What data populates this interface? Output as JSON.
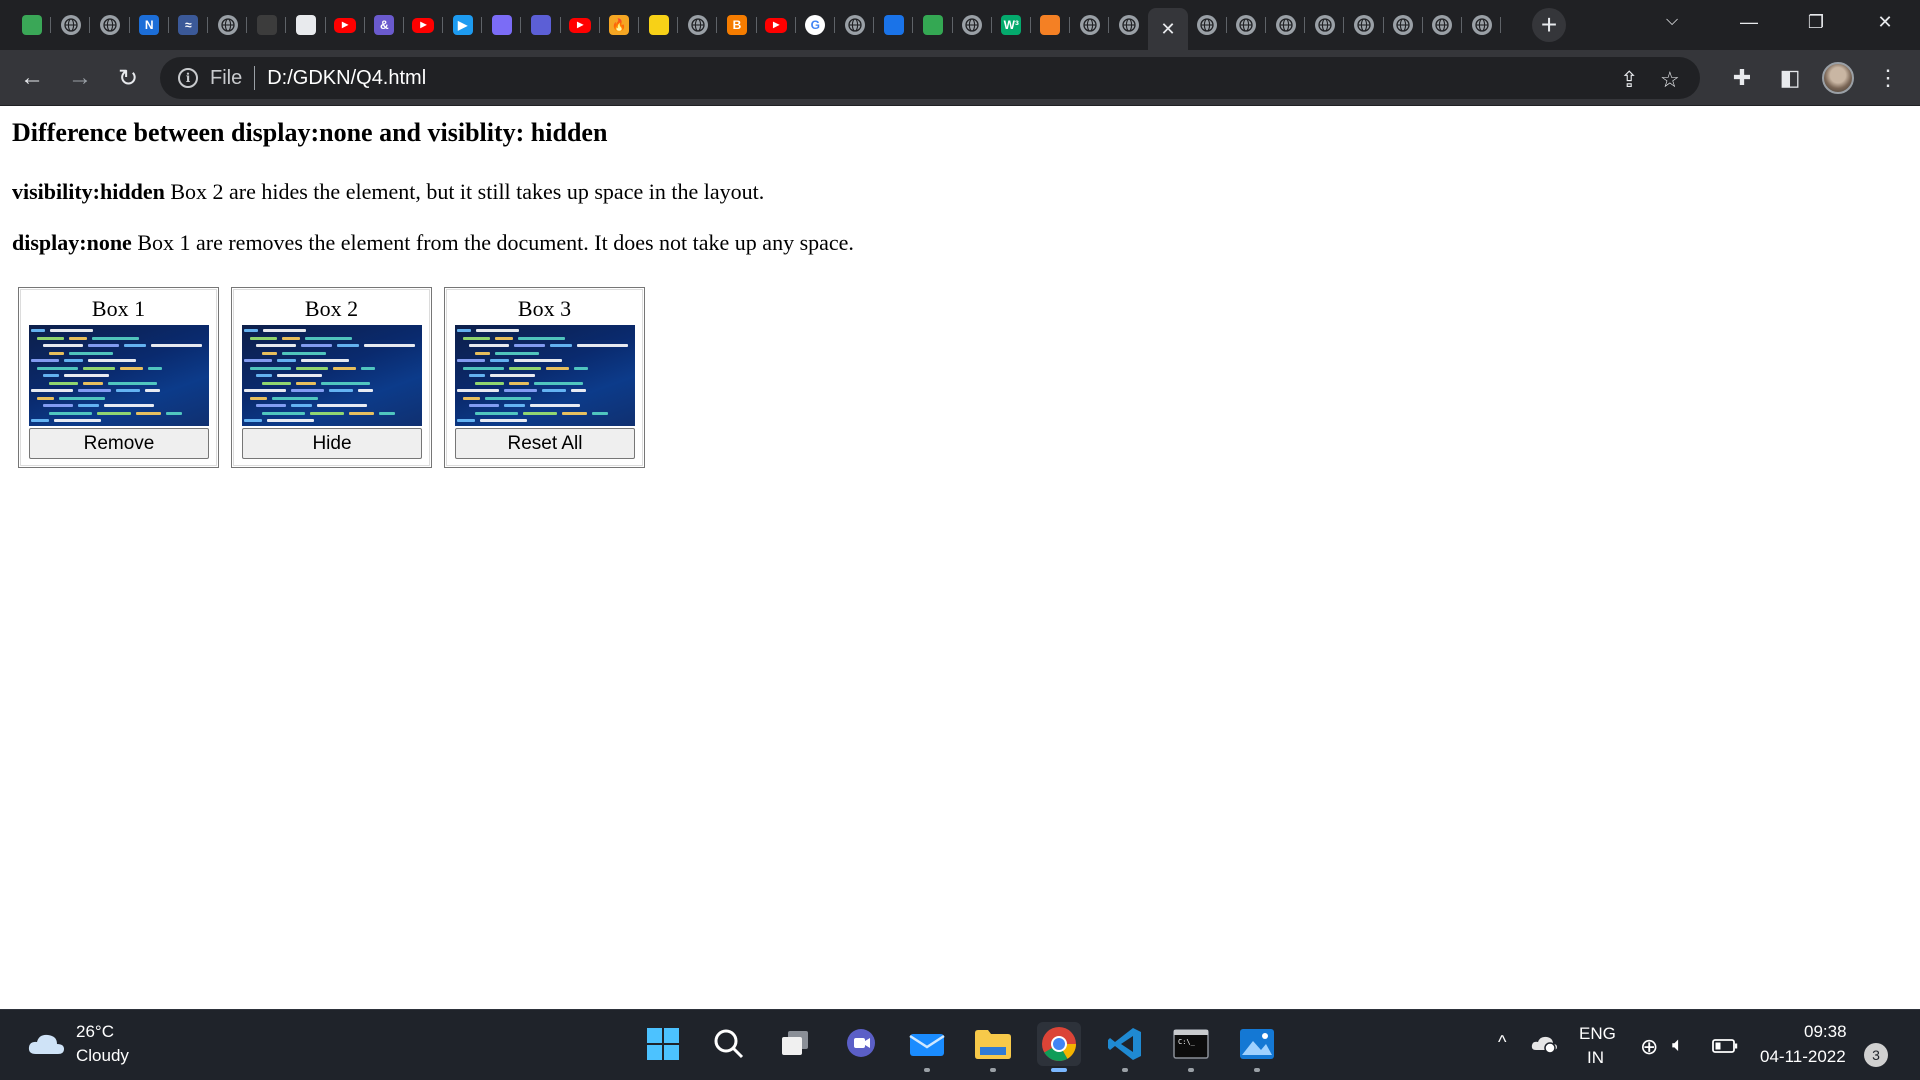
{
  "browser": {
    "tabs": [
      {
        "icon": "hexagon-green-icon",
        "color": "#3aa757"
      },
      {
        "icon": "globe-icon"
      },
      {
        "icon": "globe-icon"
      },
      {
        "icon": "notion-icon",
        "glyph": "N",
        "color": "#1c6ed8"
      },
      {
        "icon": "wave-icon",
        "glyph": "≈",
        "color": "#3b5998"
      },
      {
        "icon": "globe-icon"
      },
      {
        "icon": "dark-app-icon",
        "color": "#3c3c3c"
      },
      {
        "icon": "diamond-grid-icon",
        "color": "#e8eaed"
      },
      {
        "icon": "youtube-icon"
      },
      {
        "icon": "threads-icon",
        "glyph": "&",
        "color": "#6a5acd"
      },
      {
        "icon": "youtube-icon"
      },
      {
        "icon": "play-circle-icon",
        "glyph": "▶",
        "color": "#1d9bf0"
      },
      {
        "icon": "orb-icon",
        "color": "#7b6cf6"
      },
      {
        "icon": "purple-rect-icon",
        "color": "#5c5fd6"
      },
      {
        "icon": "youtube-icon"
      },
      {
        "icon": "flame-icon",
        "glyph": "🔥",
        "color": "#f5a623"
      },
      {
        "icon": "cup-icon",
        "color": "#f7d117"
      },
      {
        "icon": "globe-icon"
      },
      {
        "icon": "blogger-icon",
        "glyph": "B",
        "color": "#f57c00"
      },
      {
        "icon": "youtube-icon"
      },
      {
        "icon": "google-icon",
        "glyph": "G",
        "color": "#ffffff"
      },
      {
        "icon": "globe-icon"
      },
      {
        "icon": "classroom-icon",
        "color": "#1a73e8"
      },
      {
        "icon": "drive-icon",
        "color": "#34a853"
      },
      {
        "icon": "globe-icon"
      },
      {
        "icon": "w3-icon",
        "glyph": "W³",
        "color": "#04aa6d"
      },
      {
        "icon": "stack-icon",
        "color": "#f48024"
      },
      {
        "icon": "globe-icon"
      },
      {
        "icon": "globe-icon"
      },
      {
        "icon": "tab-close-icon",
        "active": true
      },
      {
        "icon": "globe-icon"
      },
      {
        "icon": "globe-icon"
      },
      {
        "icon": "globe-icon"
      },
      {
        "icon": "globe-icon"
      },
      {
        "icon": "globe-icon"
      },
      {
        "icon": "globe-icon"
      },
      {
        "icon": "globe-icon"
      },
      {
        "icon": "globe-icon"
      }
    ],
    "scheme": "File",
    "url": "D:/GDKN/Q4.html"
  },
  "page": {
    "heading": "Difference between display:none and visiblity: hidden",
    "p1_bold": "visibility:hidden",
    "p1_text": " Box 2 are hides the element, but it still takes up space in the layout.",
    "p2_bold": "display:none",
    "p2_text": " Box 1 are removes the element from the document. It does not take up any space.",
    "boxes": [
      {
        "title": "Box 1",
        "button": "Remove"
      },
      {
        "title": "Box 2",
        "button": "Hide"
      },
      {
        "title": "Box 3",
        "button": "Reset All"
      }
    ]
  },
  "taskbar": {
    "weather_temp": "26°C",
    "weather_cond": "Cloudy",
    "lang_top": "ENG",
    "lang_bottom": "IN",
    "time": "09:38",
    "date": "04-11-2022",
    "notifications": "3"
  }
}
